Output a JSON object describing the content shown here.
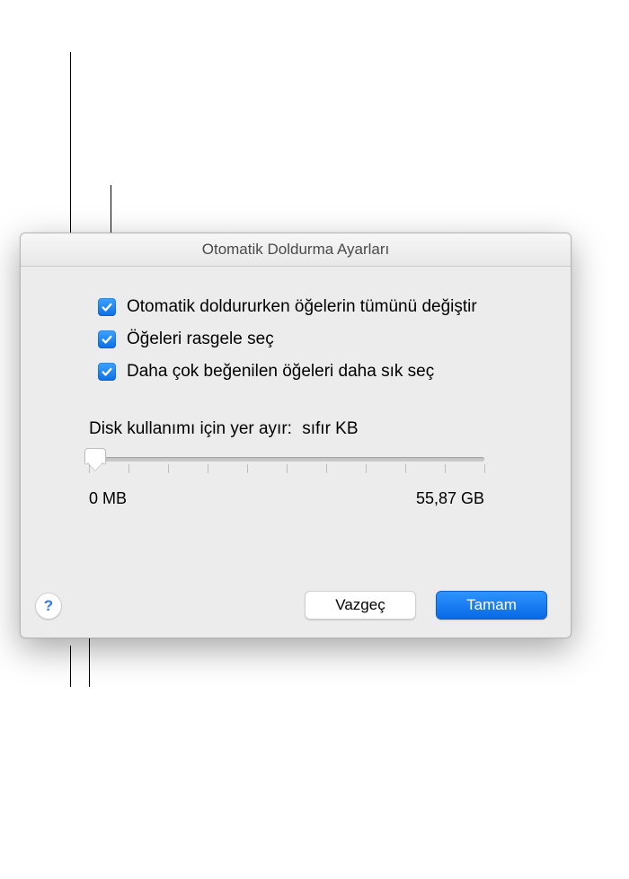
{
  "dialog": {
    "title": "Otomatik Doldurma Ayarları",
    "checkboxes": [
      {
        "label": "Otomatik doldururken öğelerin tümünü değiştir",
        "checked": true
      },
      {
        "label": "Öğeleri rasgele seç",
        "checked": true
      },
      {
        "label": "Daha çok beğenilen öğeleri daha sık seç",
        "checked": true
      }
    ],
    "slider": {
      "label": "Disk kullanımı için yer ayır:",
      "value_text": "sıfır KB",
      "min_label": "0 MB",
      "max_label": "55,87 GB"
    },
    "buttons": {
      "cancel": "Vazgeç",
      "ok": "Tamam"
    },
    "help_glyph": "?"
  }
}
